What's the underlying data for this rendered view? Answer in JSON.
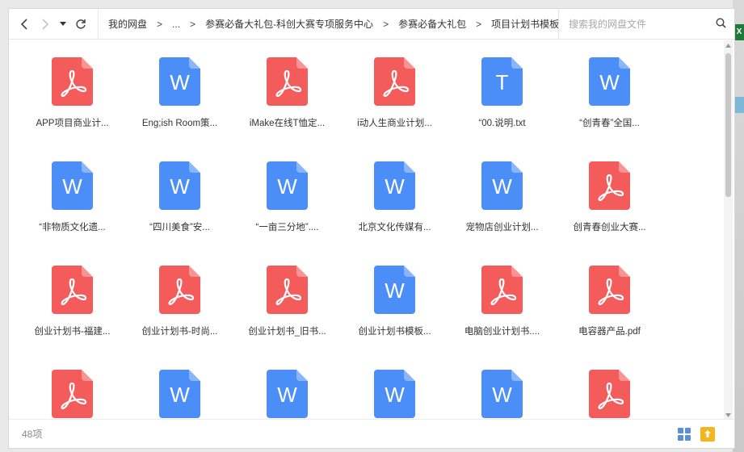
{
  "nav": {
    "breadcrumbs": [
      "我的网盘",
      "...",
      "参赛必备大礼包-科创大赛专项服务中心",
      "参赛必备大礼包",
      "项目计划书模板"
    ],
    "separator": ">",
    "search_placeholder": "搜索我的网盘文件"
  },
  "files": [
    {
      "name": "APP项目商业计...",
      "type": "pdf-icon"
    },
    {
      "name": "Eng;ish Room策...",
      "type": "word-icon"
    },
    {
      "name": "iMake在线T恤定...",
      "type": "pdf-icon"
    },
    {
      "name": "i动人生商业计划...",
      "type": "pdf-icon"
    },
    {
      "name": "“00.说明.txt",
      "type": "text-icon"
    },
    {
      "name": "“创青春”全国...",
      "type": "word-icon"
    },
    {
      "name": "“非物质文化遗...",
      "type": "word-icon"
    },
    {
      "name": "“四川美食”安...",
      "type": "word-icon"
    },
    {
      "name": "“一亩三分地”....",
      "type": "word-icon"
    },
    {
      "name": "北京文化传媒有...",
      "type": "word-icon"
    },
    {
      "name": "宠物店创业计划...",
      "type": "word-icon"
    },
    {
      "name": "创青春创业大赛...",
      "type": "pdf-icon"
    },
    {
      "name": "创业计划书-福建...",
      "type": "pdf-icon"
    },
    {
      "name": "创业计划书-时尚...",
      "type": "pdf-icon"
    },
    {
      "name": "创业计划书_旧书...",
      "type": "pdf-icon"
    },
    {
      "name": "创业计划书模板...",
      "type": "word-icon"
    },
    {
      "name": "电脑创业计划书....",
      "type": "pdf-icon"
    },
    {
      "name": "电容器产品.pdf",
      "type": "pdf-icon"
    },
    {
      "name": "",
      "type": "pdf-icon"
    },
    {
      "name": "",
      "type": "word-icon"
    },
    {
      "name": "",
      "type": "word-icon"
    },
    {
      "name": "",
      "type": "word-icon"
    },
    {
      "name": "",
      "type": "word-icon"
    },
    {
      "name": "",
      "type": "pdf-icon"
    }
  ],
  "status": {
    "item_count": "48项"
  },
  "colors": {
    "pdf": "#f45b5b",
    "word": "#4c8ef7",
    "text": "#4c8ef7",
    "excel_badge": "#1f7a3a"
  },
  "icon_letters": {
    "word": "W",
    "text": "T",
    "excel": "X"
  }
}
